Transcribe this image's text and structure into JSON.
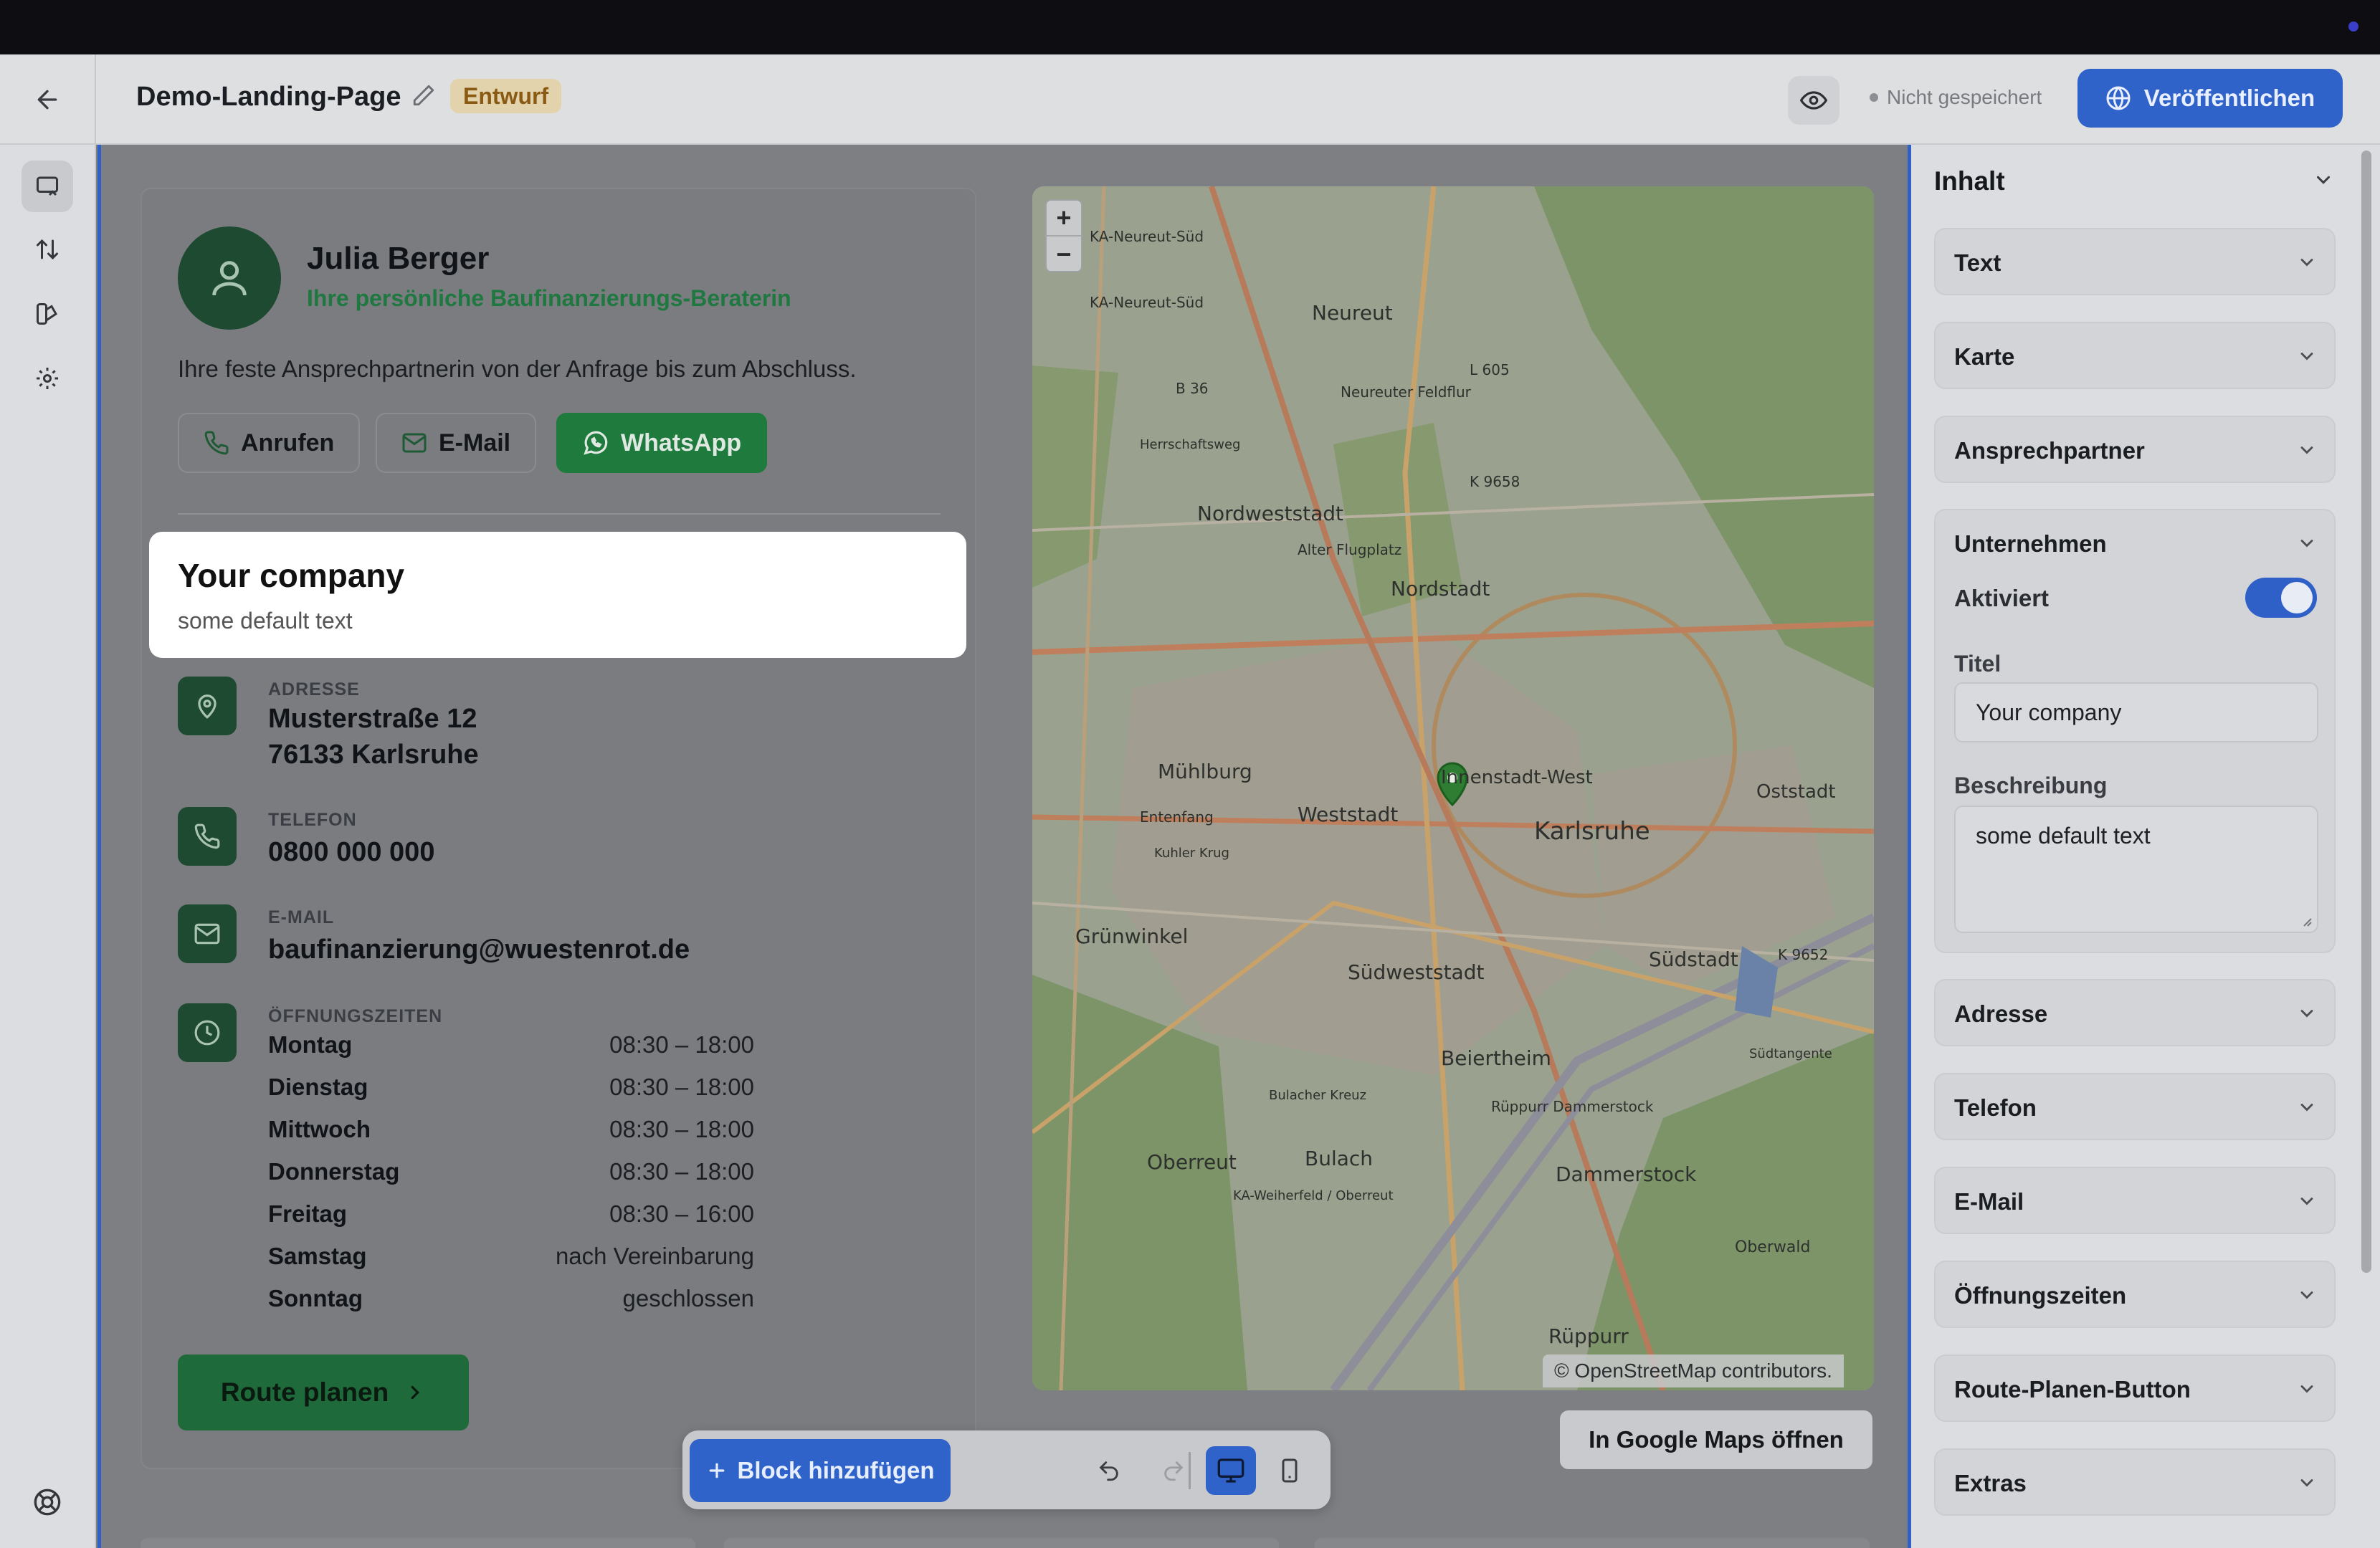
{
  "header": {
    "page_title": "Demo-Landing-Page",
    "status_badge": "Entwurf",
    "save_status": "Nicht gespeichert",
    "publish_label": "Veröffentlichen"
  },
  "contact": {
    "name": "Julia Berger",
    "role": "Ihre persönliche Baufinanzierungs-Beraterin",
    "intro": "Ihre feste Ansprechpartnerin von der Anfrage bis zum Abschluss.",
    "buttons": {
      "call": "Anrufen",
      "email": "E-Mail",
      "whatsapp": "WhatsApp"
    }
  },
  "company": {
    "title": "Your company",
    "description": "some default text"
  },
  "address": {
    "label": "ADRESSE",
    "line1": "Musterstraße 12",
    "line2": "76133 Karlsruhe"
  },
  "phone": {
    "label": "TELEFON",
    "value": "0800 000 000"
  },
  "email": {
    "label": "E-MAIL",
    "value": "baufinanzierung@wuestenrot.de"
  },
  "hours": {
    "label": "ÖFFNUNGSZEITEN",
    "rows": [
      {
        "day": "Montag",
        "time": "08:30 – 18:00"
      },
      {
        "day": "Dienstag",
        "time": "08:30 – 18:00"
      },
      {
        "day": "Mittwoch",
        "time": "08:30 – 18:00"
      },
      {
        "day": "Donnerstag",
        "time": "08:30 – 18:00"
      },
      {
        "day": "Freitag",
        "time": "08:30 – 16:00"
      },
      {
        "day": "Samstag",
        "time": "nach Vereinbarung"
      },
      {
        "day": "Sonntag",
        "time": "geschlossen"
      }
    ]
  },
  "route_button": "Route planen",
  "map": {
    "zoom_in": "+",
    "zoom_out": "−",
    "attribution": "© OpenStreetMap contributors.",
    "google_maps_button": "In Google Maps öffnen",
    "labels": [
      "KA-Neureut-Süd",
      "KA-Neureut-Süd",
      "Neureut",
      "B 36",
      "L 605",
      "Neureuter Feldflur",
      "Herrschaftsweg",
      "K 9658",
      "Nordweststadt",
      "Alter Flugplatz",
      "Nordstadt",
      "Mühlburg",
      "Innenstadt-West",
      "Oststadt",
      "Weststadt",
      "Karlsruhe",
      "Entenfang",
      "Kuhler Krug",
      "Grünwinkel",
      "Südweststadt",
      "Südstadt",
      "K 9652",
      "Beiertheim",
      "Bulacher Kreuz",
      "Rüppurr Dammerstock",
      "Oberreut",
      "Bulach",
      "Dammerstock",
      "KA-Weiherfeld / Oberreut",
      "Oberwald",
      "Rüppurr",
      "Südtangente"
    ]
  },
  "toolbar": {
    "add_block": "Block hinzufügen"
  },
  "right_panel": {
    "heading": "Inhalt",
    "sections": [
      "Text",
      "Karte",
      "Ansprechpartner"
    ],
    "expanded": {
      "label": "Unternehmen",
      "activated_label": "Aktiviert",
      "activated": true,
      "title_label": "Titel",
      "title_value": "Your company",
      "description_label": "Beschreibung",
      "description_value": "some default text"
    },
    "sections_after": [
      "Adresse",
      "Telefon",
      "E-Mail",
      "Öffnungszeiten",
      "Route-Planen-Button",
      "Extras"
    ]
  },
  "colors": {
    "accent_blue": "#2f63c9",
    "brand_green": "#1e4a31",
    "whatsapp_green": "#1f7a3d",
    "badge_bg": "#e3d3ad",
    "badge_text": "#8a5a12"
  }
}
